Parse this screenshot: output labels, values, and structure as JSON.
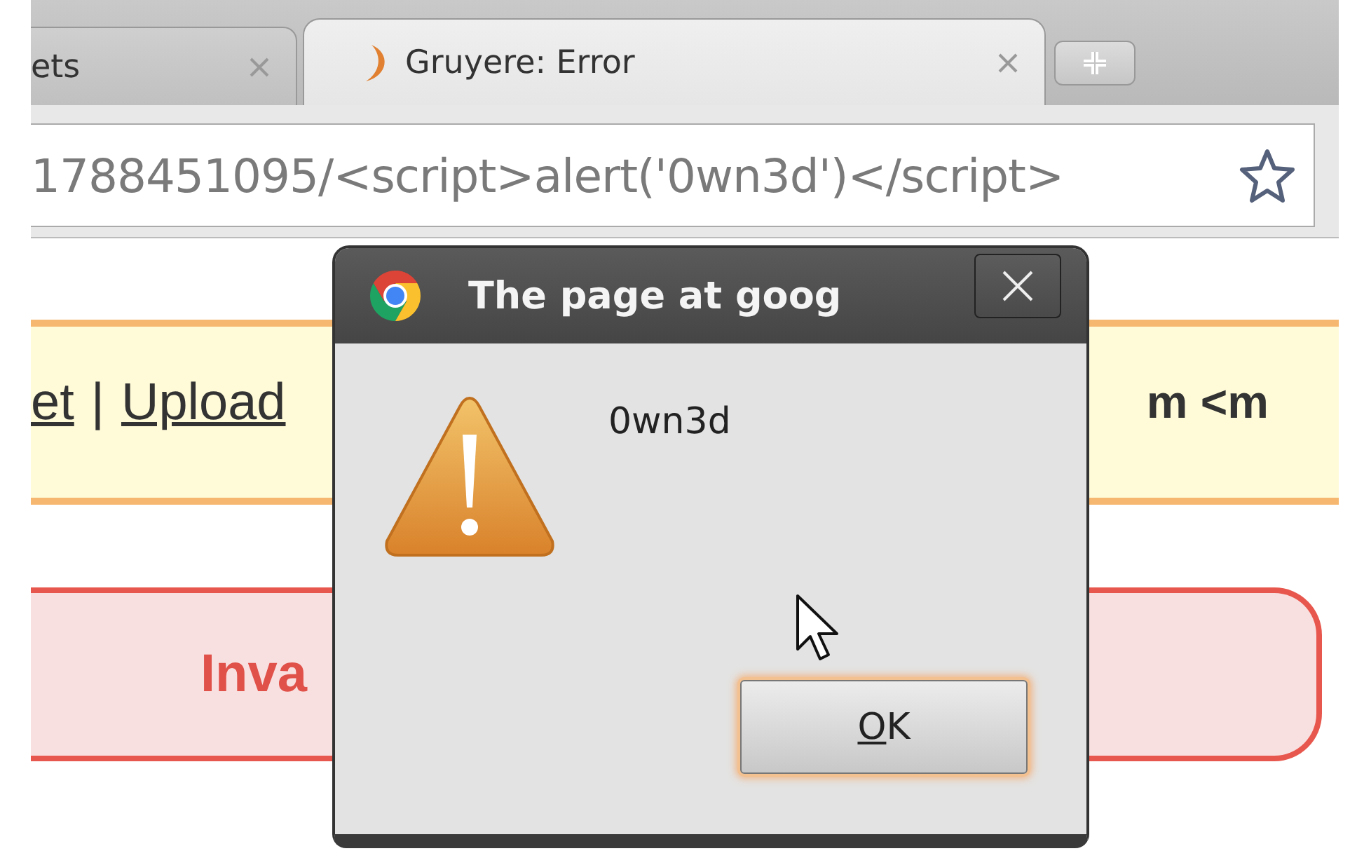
{
  "browser": {
    "tabs": [
      {
        "title": "ets",
        "selected": false
      },
      {
        "title": "Gruyere: Error",
        "selected": true
      }
    ],
    "address": "1788451095/<script>alert('0wn3d')</script>"
  },
  "page": {
    "menu": [
      {
        "kind": "link",
        "text": "et"
      },
      {
        "kind": "separator",
        "text": "|"
      },
      {
        "kind": "link",
        "text": "Upload"
      }
    ],
    "user": "m <m",
    "error": "Inva"
  },
  "dialog": {
    "title": "The page at goog",
    "message": "0wn3d",
    "buttons": [
      {
        "label": "OK",
        "focused": true
      }
    ]
  }
}
